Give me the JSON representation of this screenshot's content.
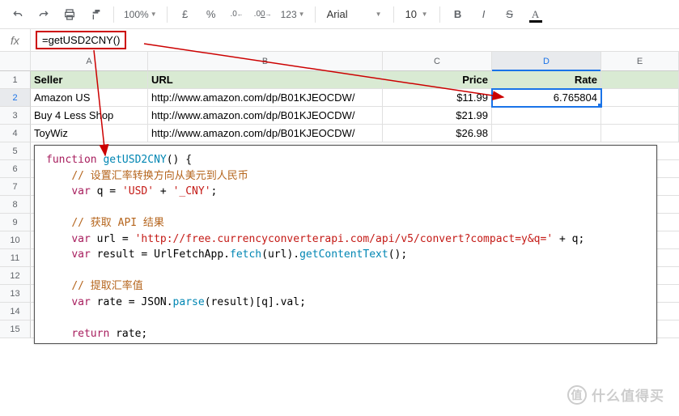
{
  "toolbar": {
    "zoom": "100%",
    "currency": "£",
    "percent": "%",
    "dec_dec": ".0←",
    "dec_inc": ".00→",
    "more_fmt": "123",
    "font": "Arial",
    "font_size": "10",
    "bold": "B",
    "italic": "I",
    "strike": "S",
    "text_color": "A"
  },
  "fx_label": "fx",
  "formula": "=getUSD2CNY()",
  "columns": [
    "A",
    "B",
    "C",
    "D",
    "E"
  ],
  "rows": [
    "1",
    "2",
    "3",
    "4",
    "5",
    "6",
    "7",
    "8",
    "9",
    "10",
    "11",
    "12",
    "13",
    "14",
    "15"
  ],
  "hdr": {
    "a": "Seller",
    "b": "URL",
    "c": "Price",
    "d": "Rate"
  },
  "r2": {
    "a": "Amazon US",
    "b": "http://www.amazon.com/dp/B01KJEOCDW/",
    "c": "$11.99",
    "d": "6.765804"
  },
  "r3": {
    "a": "Buy 4 Less Shop",
    "b": "http://www.amazon.com/dp/B01KJEOCDW/",
    "c": "$21.99"
  },
  "r4": {
    "a": "ToyWiz",
    "b": "http://www.amazon.com/dp/B01KJEOCDW/",
    "c": "$26.98"
  },
  "code": {
    "l1a": "function",
    "l1b": "getUSD2CNY",
    "l1c": "() {",
    "l2": "// 设置汇率转换方向从美元到人民币",
    "l3a": "var",
    "l3b": "q = ",
    "l3c": "'USD'",
    "l3d": " + ",
    "l3e": "'_CNY'",
    "l3f": ";",
    "l5": "// 获取 API 结果",
    "l6a": "var",
    "l6b": "url = ",
    "l6c": "'http://free.currencyconverterapi.com/api/v5/convert?compact=y&q='",
    "l6d": " + q;",
    "l7a": "var",
    "l7b": "result = UrlFetchApp.",
    "l7c": "fetch",
    "l7d": "(url).",
    "l7e": "getContentText",
    "l7f": "();",
    "l9": "// 提取汇率值",
    "l10a": "var",
    "l10b": "rate = JSON.",
    "l10c": "parse",
    "l10d": "(result)[q].val;",
    "l12a": "return",
    "l12b": "rate;",
    "l13": "}"
  },
  "watermark": "什么值得买",
  "chart_data": {
    "type": "table",
    "title": "",
    "columns": [
      "Seller",
      "URL",
      "Price",
      "Rate"
    ],
    "rows": [
      [
        "Amazon US",
        "http://www.amazon.com/dp/B01KJEOCDW/",
        "$11.99",
        "6.765804"
      ],
      [
        "Buy 4 Less Shop",
        "http://www.amazon.com/dp/B01KJEOCDW/",
        "$21.99",
        ""
      ],
      [
        "ToyWiz",
        "http://www.amazon.com/dp/B01KJEOCDW/",
        "$26.98",
        ""
      ]
    ]
  }
}
